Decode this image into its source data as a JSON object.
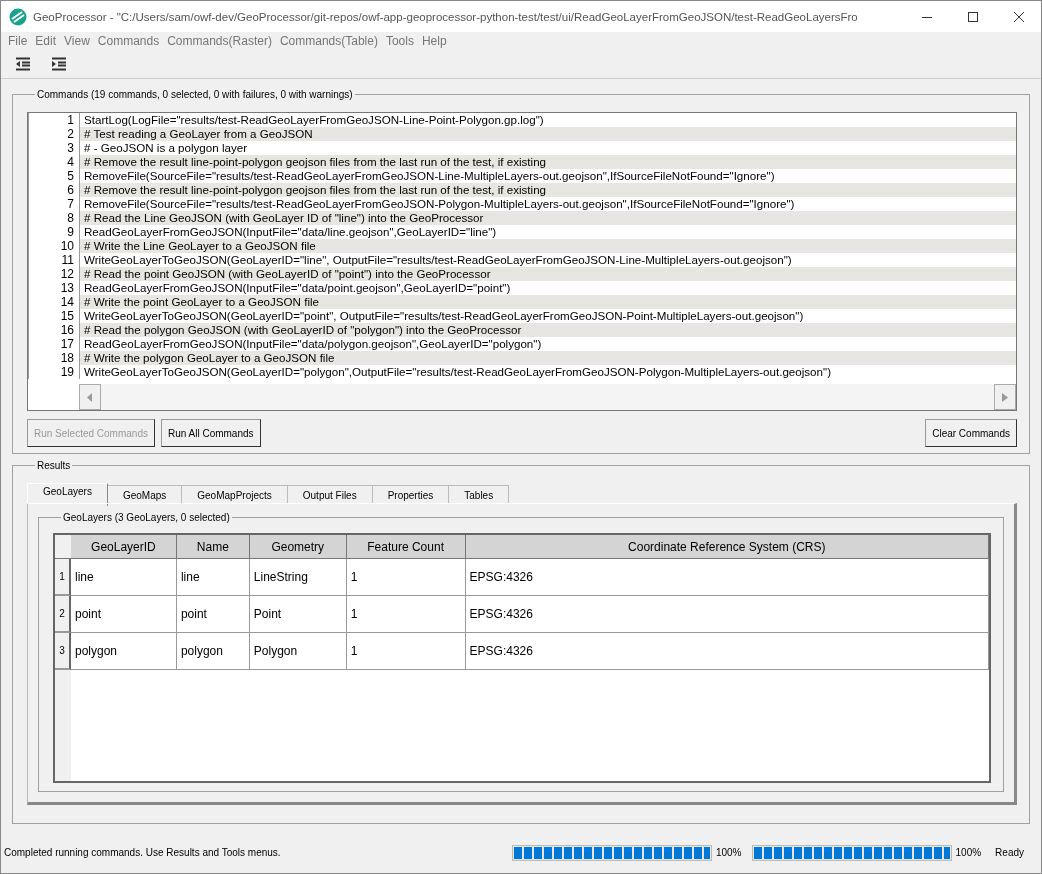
{
  "window": {
    "title": "GeoProcessor - \"C:/Users/sam/owf-dev/GeoProcessor/git-repos/owf-app-geoprocessor-python-test/test/ui/ReadGeoLayerFromGeoJSON/test-ReadGeoLayersFro"
  },
  "menu": [
    "File",
    "Edit",
    "View",
    "Commands",
    "Commands(Raster)",
    "Commands(Table)",
    "Tools",
    "Help"
  ],
  "commands": {
    "title": "Commands (19 commands, 0 selected, 0 with failures, 0 with warnings)",
    "lines": [
      {
        "number": "1",
        "text": "StartLog(LogFile=\"results/test-ReadGeoLayerFromGeoJSON-Line-Point-Polygon.gp.log\")"
      },
      {
        "number": "2",
        "text": "# Test reading a GeoLayer from a GeoJSON"
      },
      {
        "number": "3",
        "text": "# - GeoJSON is a polygon layer"
      },
      {
        "number": "4",
        "text": "# Remove the result line-point-polygon geojson files from the last run of the test, if existing"
      },
      {
        "number": "5",
        "text": "RemoveFile(SourceFile=\"results/test-ReadGeoLayerFromGeoJSON-Line-MultipleLayers-out.geojson\",IfSourceFileNotFound=\"Ignore\")"
      },
      {
        "number": "6",
        "text": "# Remove the result line-point-polygon geojson files from the last run of the test, if existing"
      },
      {
        "number": "7",
        "text": "RemoveFile(SourceFile=\"results/test-ReadGeoLayerFromGeoJSON-Polygon-MultipleLayers-out.geojson\",IfSourceFileNotFound=\"Ignore\")"
      },
      {
        "number": "8",
        "text": "# Read the Line GeoJSON (with GeoLayer ID of \"line\") into the GeoProcessor"
      },
      {
        "number": "9",
        "text": "ReadGeoLayerFromGeoJSON(InputFile=\"data/line.geojson\",GeoLayerID=\"line\")"
      },
      {
        "number": "10",
        "text": "# Write the Line GeoLayer to a GeoJSON file"
      },
      {
        "number": "11",
        "text": "WriteGeoLayerToGeoJSON(GeoLayerID=\"line\", OutputFile=\"results/test-ReadGeoLayerFromGeoJSON-Line-MultipleLayers-out.geojson\")"
      },
      {
        "number": "12",
        "text": "# Read the point GeoJSON (with GeoLayerID of \"point\") into the GeoProcessor"
      },
      {
        "number": "13",
        "text": "ReadGeoLayerFromGeoJSON(InputFile=\"data/point.geojson\",GeoLayerID=\"point\")"
      },
      {
        "number": "14",
        "text": "# Write the point GeoLayer to a GeoJSON file"
      },
      {
        "number": "15",
        "text": "WriteGeoLayerToGeoJSON(GeoLayerID=\"point\", OutputFile=\"results/test-ReadGeoLayerFromGeoJSON-Point-MultipleLayers-out.geojson\")"
      },
      {
        "number": "16",
        "text": "# Read the polygon GeoJSON (with GeoLayerID of \"polygon\") into the GeoProcessor"
      },
      {
        "number": "17",
        "text": "ReadGeoLayerFromGeoJSON(InputFile=\"data/polygon.geojson\",GeoLayerID=\"polygon\")"
      },
      {
        "number": "18",
        "text": "# Write the polygon GeoLayer to a GeoJSON file"
      },
      {
        "number": "19",
        "text": "WriteGeoLayerToGeoJSON(GeoLayerID=\"polygon\",OutputFile=\"results/test-ReadGeoLayerFromGeoJSON-Polygon-MultipleLayers-out.geojson\")"
      }
    ],
    "buttons": [
      {
        "label": "Run Selected Commands",
        "disabled": true
      },
      {
        "label": "Run All Commands",
        "disabled": false
      }
    ],
    "clear_button": "Clear Commands"
  },
  "results": {
    "title": "Results",
    "tabs": [
      {
        "label": "GeoLayers",
        "selected": true
      },
      {
        "label": "GeoMaps",
        "selected": false
      },
      {
        "label": "GeoMapProjects",
        "selected": false
      },
      {
        "label": "Output Files",
        "selected": false
      },
      {
        "label": "Properties",
        "selected": false
      },
      {
        "label": "Tables",
        "selected": false
      }
    ],
    "group_title": "GeoLayers (3 GeoLayers, 0 selected)",
    "table": {
      "columns": [
        "GeoLayerID",
        "Name",
        "Geometry",
        "Feature Count",
        "Coordinate Reference System (CRS)"
      ],
      "rows": [
        {
          "number": "1",
          "cells": [
            "line",
            "line",
            "LineString",
            "1",
            "EPSG:4326"
          ]
        },
        {
          "number": "2",
          "cells": [
            "point",
            "point",
            "Point",
            "1",
            "EPSG:4326"
          ]
        },
        {
          "number": "3",
          "cells": [
            "polygon",
            "polygon",
            "Polygon",
            "1",
            "EPSG:4326"
          ]
        }
      ]
    }
  },
  "status_bar": {
    "message": "Completed running commands. Use Results and Tools menus.",
    "progress": [
      {
        "level": 1.0,
        "reading": "100%"
      },
      {
        "level": 1.0,
        "reading": "100%"
      }
    ],
    "state": "Ready"
  }
}
